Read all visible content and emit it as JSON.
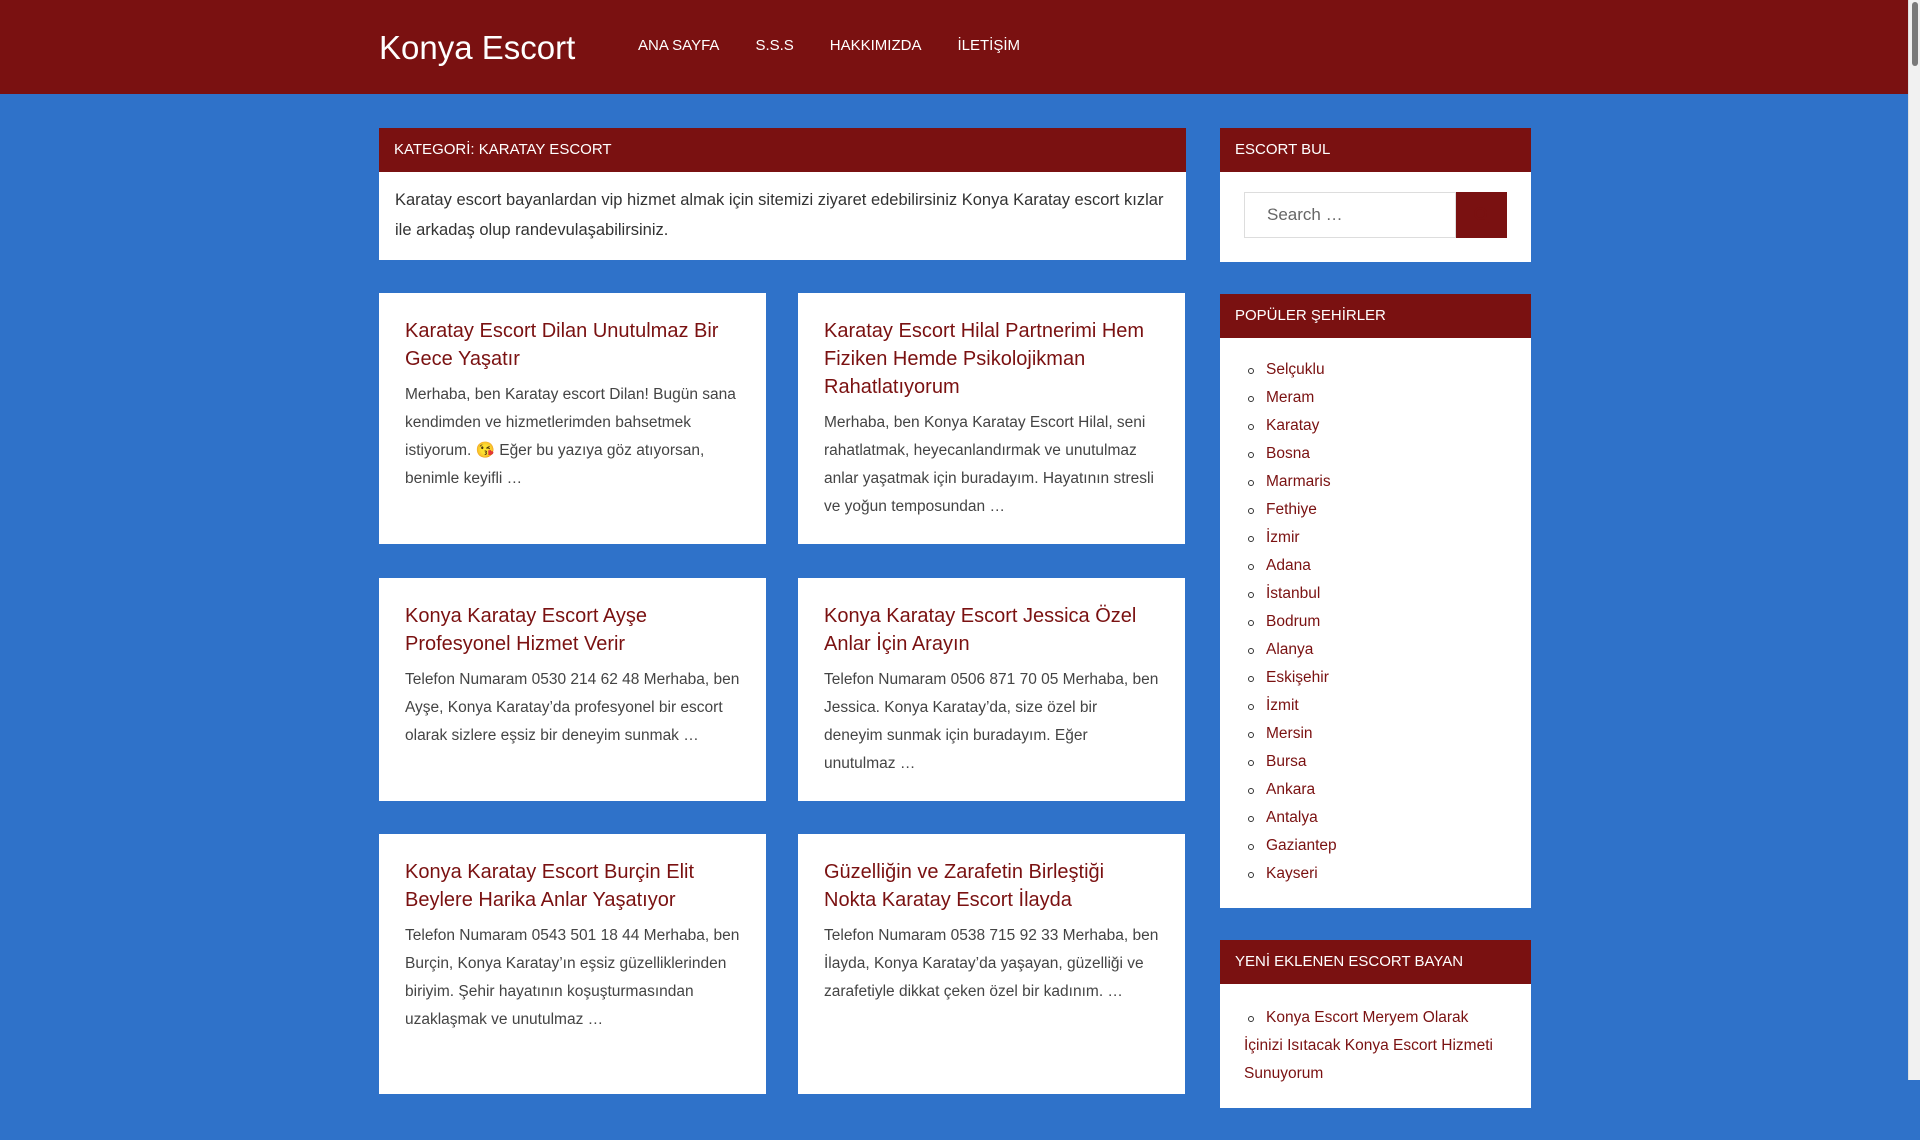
{
  "header": {
    "site_title": "Konya Escort",
    "nav": [
      "ANA SAYFA",
      "S.S.S",
      "HAKKIMIZDA",
      "İLETİŞİM"
    ]
  },
  "archive": {
    "title": "KATEGORİ: KARATAY ESCORT",
    "description": "Karatay escort bayanlardan vip hizmet almak için sitemizi ziyaret edebilirsiniz Konya Karatay escort kızlar ile arkadaş olup randevulaşabilirsiniz."
  },
  "posts": [
    {
      "title": "Karatay Escort Dilan Unutulmaz Bir Gece Yaşatır",
      "excerpt": "Merhaba, ben Karatay escort Dilan! Bugün sana kendimden ve hizmetlerimden bahsetmek istiyorum. 😘 Eğer bu yazıya göz atıyorsan, benimle keyifli …"
    },
    {
      "title": "Karatay Escort Hilal Partnerimi Hem Fiziken Hemde Psikolojikman Rahatlatıyorum",
      "excerpt": "Merhaba, ben Konya Karatay Escort Hilal, seni rahatlatmak, heyecanlandırmak ve unutulmaz anlar yaşatmak için buradayım. Hayatının stresli ve yoğun temposundan …"
    },
    {
      "title": "Konya Karatay Escort Ayşe Profesyonel Hizmet Verir",
      "excerpt": "Telefon Numaram 0530 214 62 48 Merhaba, ben Ayşe, Konya Karatay’da profesyonel bir escort olarak sizlere eşsiz bir deneyim sunmak …"
    },
    {
      "title": "Konya Karatay Escort Jessica Özel Anlar İçin Arayın",
      "excerpt": "Telefon Numaram 0506 871 70 05 Merhaba, ben Jessica. Konya Karatay’da, size özel bir deneyim sunmak için buradayım. Eğer unutulmaz …"
    },
    {
      "title": "Konya Karatay Escort Burçin Elit Beylere Harika Anlar Yaşatıyor",
      "excerpt": "Telefon Numaram 0543 501 18 44 Merhaba, ben Burçin, Konya Karatay’ın eşsiz güzelliklerinden biriyim. Şehir hayatının koşuşturmasından uzaklaşmak ve unutulmaz …"
    },
    {
      "title": "Güzelliğin ve Zarafetin Birleştiği Nokta Karatay Escort İlayda",
      "excerpt": "Telefon Numaram 0538 715 92 33 Merhaba, ben İlayda, Konya Karatay’da yaşayan, güzelliği ve zarafetiyle dikkat çeken özel bir kadınım. …"
    }
  ],
  "sidebar": {
    "search": {
      "title": "ESCORT BUL",
      "placeholder": "Search …"
    },
    "cities": {
      "title": "POPÜLER ŞEHİRLER",
      "items": [
        "Selçuklu",
        "Meram",
        "Karatay",
        "Bosna",
        "Marmaris",
        "Fethiye",
        "İzmir",
        "Adana",
        "İstanbul",
        "Bodrum",
        "Alanya",
        "Eskişehir",
        "İzmit",
        "Mersin",
        "Bursa",
        "Ankara",
        "Antalya",
        "Gaziantep",
        "Kayseri"
      ]
    },
    "recent": {
      "title": "YENİ EKLENEN ESCORT BAYAN",
      "items": [
        "Konya Escort Meryem Olarak İçinizi Isıtacak Konya Escort Hizmeti Sunuyorum"
      ]
    }
  },
  "colors": {
    "background": "#2f72c9",
    "brand": "#7a1111"
  }
}
